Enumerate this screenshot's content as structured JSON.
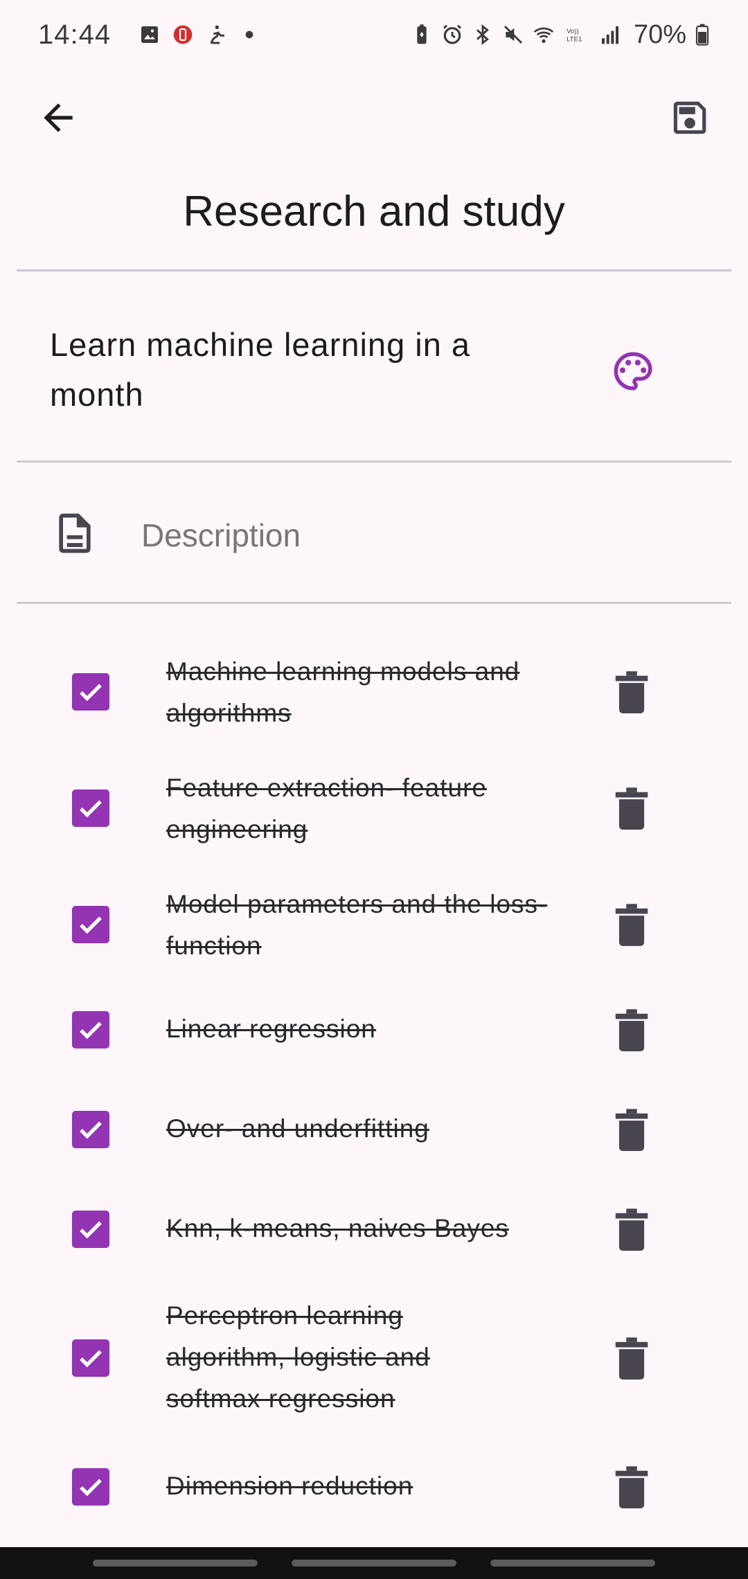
{
  "status_bar": {
    "time": "14:44",
    "battery": "70%",
    "left_icons": [
      "image-icon",
      "app-notification-icon",
      "accessibility-icon",
      "dot-icon"
    ],
    "right_icons": [
      "battery-saver-icon",
      "alarm-icon",
      "bluetooth-icon",
      "mute-icon",
      "wifi-icon",
      "volte-icon",
      "signal-icon",
      "battery-icon"
    ],
    "volte_label": "Vo)) LTE1"
  },
  "toolbar": {
    "back_icon": "arrow-back-icon",
    "save_icon": "save-icon"
  },
  "header": {
    "title": "Research and study"
  },
  "note": {
    "title": "Learn machine learning in a month",
    "palette_icon": "palette-icon",
    "palette_color": "#9334b3"
  },
  "description": {
    "icon": "document-icon",
    "placeholder": "Description",
    "value": ""
  },
  "checklist": {
    "checkbox_color": "#9334b3",
    "items": [
      {
        "label": "Machine learning models and algorithms",
        "checked": true
      },
      {
        "label": "Feature extraction- feature engineering",
        "checked": true
      },
      {
        "label": "Model parameters and the loss-function",
        "checked": true
      },
      {
        "label": "Linear regression",
        "checked": true
      },
      {
        "label": "Over- and underfitting",
        "checked": true
      },
      {
        "label": "Knn, k-means, naives Bayes",
        "checked": true
      },
      {
        "label": "Perceptron learning algorithm, logistic and softmax regression",
        "checked": true
      },
      {
        "label": "Dimension reduction",
        "checked": true
      }
    ]
  }
}
